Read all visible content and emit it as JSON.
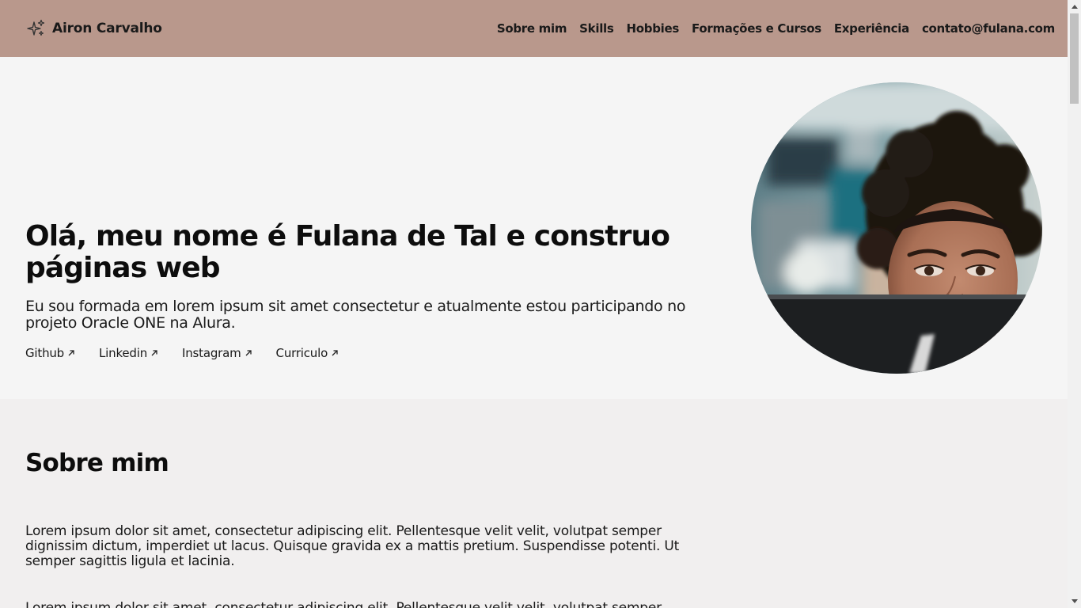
{
  "header": {
    "brand_name": "Airon Carvalho",
    "brand_icon": "sparkles-icon",
    "nav": [
      {
        "label": "Sobre mim"
      },
      {
        "label": "Skills"
      },
      {
        "label": "Hobbies"
      },
      {
        "label": "Formações e Cursos"
      },
      {
        "label": "Experiência"
      },
      {
        "label": "contato@fulana.com"
      }
    ]
  },
  "hero": {
    "title": "Olá, meu nome é Fulana de Tal e construo páginas web",
    "description": "Eu sou formada em lorem ipsum sit amet consectetur e atualmente estou participando no projeto Oracle ONE na Alura.",
    "links": [
      {
        "label": "Github"
      },
      {
        "label": "Linkedin"
      },
      {
        "label": "Instagram"
      },
      {
        "label": "Curriculo"
      }
    ],
    "link_icon": "arrow-up-right-icon",
    "photo_alt": "profile-photo"
  },
  "about": {
    "title": "Sobre mim",
    "paragraphs": [
      "Lorem ipsum dolor sit amet, consectetur adipiscing elit. Pellentesque velit velit, volutpat semper dignissim dictum, imperdiet ut lacus. Quisque gravida ex a mattis pretium. Suspendisse potenti. Ut semper sagittis ligula et lacinia.",
      "Lorem ipsum dolor sit amet, consectetur adipiscing elit. Pellentesque velit velit, volutpat semper"
    ]
  },
  "colors": {
    "header_bg": "#b9988c",
    "hero_bg": "#f5f5f5",
    "about_bg": "#f1efef",
    "text": "#111111"
  }
}
